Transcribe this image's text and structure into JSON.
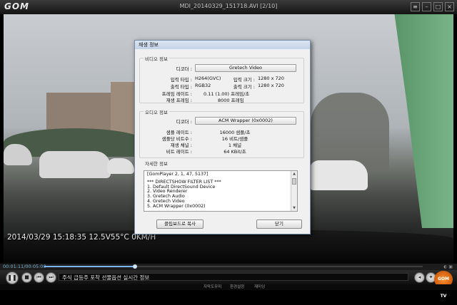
{
  "window": {
    "logo": "GOM",
    "title": "MDI_20140329_151718.AVI  [2/10]"
  },
  "video": {
    "osd_text": "2014/03/29 15:18:35 12.5V55°C 0KM/H"
  },
  "seekbar": {
    "time": "00:01:11/00:05:00",
    "progress": 0.24
  },
  "controls": {
    "ticker": "주식 급등주 포착 선물옵션 실시간 정보",
    "gomtv_label": "GOM TV"
  },
  "statusbar": {
    "items": [
      "자막도우미",
      "환경설정",
      "재미잉"
    ]
  },
  "dialog": {
    "title": "재생 정보",
    "video_section": {
      "legend": "비디오 정보",
      "codec_label": "디코더 :",
      "codec_value": "Gretech Video",
      "input_type_label": "입력 타입 :",
      "input_type_value": "H264(GVC)",
      "input_size_label": "입력 크기 :",
      "input_size_value": "1280 x 720",
      "output_type_label": "출력 타입 :",
      "output_type_value": "RGB32",
      "output_size_label": "출력 크기 :",
      "output_size_value": "1280 x 720",
      "framerate_label": "프레임 레이트 :",
      "framerate_value": "0.11 (1.00) 프레임/초",
      "played_frames_label": "재생 프레임 :",
      "played_frames_value": "8000 프레임"
    },
    "audio_section": {
      "legend": "오디오 정보",
      "codec_label": "디코더 :",
      "codec_value": "ACM Wrapper (0x0002)",
      "samplerate_label": "샘플 레이트 :",
      "samplerate_value": "16000 샘플/초",
      "bits_label": "샘플당 비트수 :",
      "bits_value": "16 비트/샘플",
      "channels_label": "재생 채널 :",
      "channels_value": "1 채널",
      "bitrate_label": "비트 레이트 :",
      "bitrate_value": "64 KBit/초"
    },
    "detail_section": {
      "legend": "자세한 정보",
      "lines": [
        "[GomPlayer 2, 1, 47, 5137]",
        "",
        "*** DIRECTSHOW FILTER LIST ***",
        "1. Default DirectSound Device",
        "2. Video Renderer",
        "3. Gretech Audio",
        "4. Gretech Video",
        "5. ACM Wrapper (0x0002)"
      ]
    },
    "copy_button": "클립보드로 복사",
    "close_button": "닫기"
  }
}
